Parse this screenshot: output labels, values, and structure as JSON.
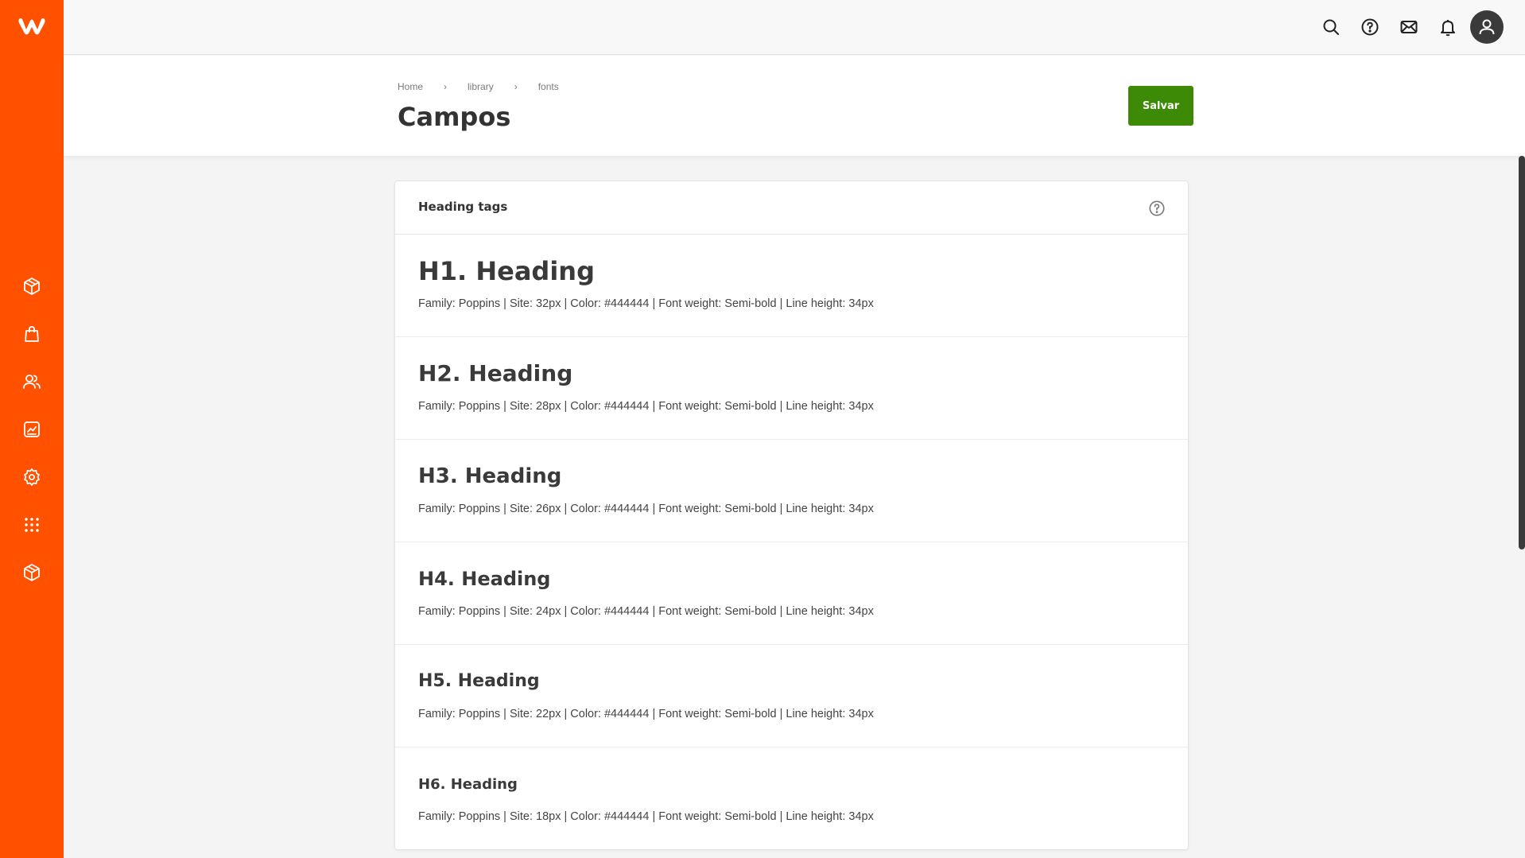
{
  "brand": {
    "accent": "#ff5100",
    "logo": "w-logo-icon"
  },
  "sidebar": {
    "items": [
      {
        "icon": "box-icon"
      },
      {
        "icon": "shopping-bag-icon"
      },
      {
        "icon": "users-icon"
      },
      {
        "icon": "chart-icon"
      },
      {
        "icon": "gear-icon"
      },
      {
        "icon": "grid-icon"
      },
      {
        "icon": "box-icon"
      }
    ]
  },
  "topbar": {
    "icons": [
      "search-icon",
      "help-icon",
      "mail-icon",
      "bell-icon",
      "user-icon"
    ]
  },
  "header": {
    "breadcrumb": [
      "Home",
      "library",
      "fonts"
    ],
    "breadcrumb_separator": "›",
    "title": "Campos",
    "save_label": "Salvar",
    "save_color": "#3d8a06"
  },
  "card": {
    "title": "Heading tags",
    "rows": [
      {
        "title": "H1. Heading",
        "desc": "Family: Poppins | Site: 32px | Color: #444444 | Font weight: Semi-bold | Line height: 34px"
      },
      {
        "title": "H2. Heading",
        "desc": "Family: Poppins | Site: 28px | Color: #444444 | Font weight: Semi-bold | Line height: 34px"
      },
      {
        "title": "H3. Heading",
        "desc": "Family: Poppins | Site: 26px | Color: #444444 | Font weight: Semi-bold | Line height: 34px"
      },
      {
        "title": "H4. Heading",
        "desc": "Family: Poppins | Site: 24px | Color: #444444 | Font weight: Semi-bold | Line height: 34px"
      },
      {
        "title": "H5. Heading",
        "desc": "Family: Poppins | Site: 22px | Color: #444444 | Font weight: Semi-bold | Line height: 34px"
      },
      {
        "title": "H6. Heading",
        "desc": "Family: Poppins | Site: 18px | Color: #444444 | Font weight: Semi-bold | Line height: 34px"
      }
    ]
  }
}
